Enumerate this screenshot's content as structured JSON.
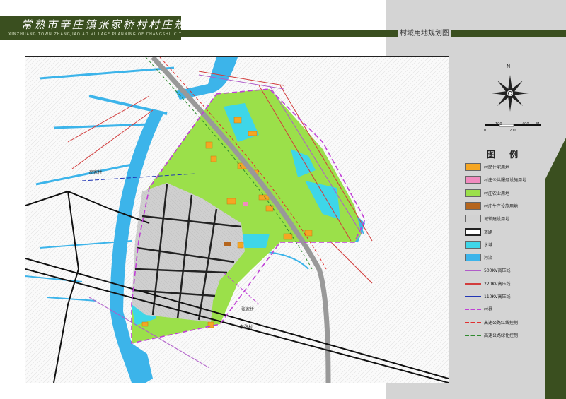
{
  "header": {
    "title": "常熟市辛庄镇张家桥村村庄规划",
    "subtitle_en": "XINZHUANG TOWN ZHANGJIAQIAO VILLAGE PLANNING OF CHANGSHU CITY",
    "sheet_title": "村域用地规划图"
  },
  "compass": {
    "label": "N",
    "icon": "compass-rose-icon"
  },
  "scale": {
    "ticks": [
      "0",
      "100",
      "200",
      "400"
    ],
    "unit": "M"
  },
  "legend": {
    "heading": "图 例",
    "items": [
      {
        "label": "村民住宅用地",
        "color": "#f5a623",
        "pattern": "fill"
      },
      {
        "label": "村庄公共服务设施用地",
        "color": "#f28bbf",
        "pattern": "fill"
      },
      {
        "label": "村庄农业用地",
        "color": "#9be04a",
        "pattern": "fill"
      },
      {
        "label": "村庄生产设施用地",
        "color": "#b5651d",
        "pattern": "fill"
      },
      {
        "label": "城镇建设用地",
        "color": "#d2d2d2",
        "pattern": "fill"
      },
      {
        "label": "道路",
        "color": "#222222",
        "pattern": "road"
      },
      {
        "label": "水域",
        "color": "#3ed6e8",
        "pattern": "fill"
      },
      {
        "label": "河流",
        "color": "#3cb4ea",
        "pattern": "fill"
      },
      {
        "label": "500KV高压线",
        "color": "#b05cc9",
        "pattern": "line"
      },
      {
        "label": "220KV高压线",
        "color": "#d23c3c",
        "pattern": "line"
      },
      {
        "label": "110KV高压线",
        "color": "#2236b5",
        "pattern": "line"
      },
      {
        "label": "村界",
        "color": "#c040d6",
        "pattern": "dash"
      },
      {
        "label": "高速公路红线控制",
        "color": "#e03030",
        "pattern": "dash"
      },
      {
        "label": "高速公路绿化控制",
        "color": "#2f8a2f",
        "pattern": "dash"
      }
    ]
  },
  "map": {
    "labels": {
      "north_village": "高家村",
      "south_village": "东张村",
      "village_center": "张家桥"
    },
    "colors": {
      "panel_bg": "#d4d4d4",
      "title_bg": "#3a4f1f",
      "accent": "#3a4f1f"
    }
  }
}
